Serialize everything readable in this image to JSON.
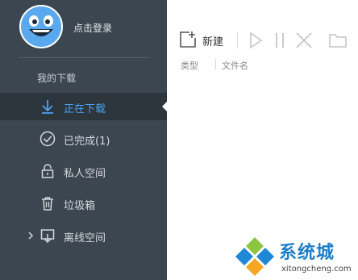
{
  "user": {
    "login_label": "点击登录"
  },
  "sidebar": {
    "section_title": "我的下载",
    "items": [
      {
        "label": "正在下载",
        "icon": "download-arrow-icon",
        "active": true
      },
      {
        "label": "已完成(1)",
        "icon": "check-circle-icon",
        "active": false
      },
      {
        "label": "私人空间",
        "icon": "lock-icon",
        "active": false
      },
      {
        "label": "垃圾箱",
        "icon": "trash-icon",
        "active": false
      },
      {
        "label": "离线空间",
        "icon": "cloud-download-icon",
        "active": false
      }
    ]
  },
  "toolbar": {
    "new_label": "新建",
    "buttons": [
      "add-icon",
      "play-icon",
      "pause-icon",
      "delete-icon",
      "folder-icon"
    ]
  },
  "columns": {
    "type": "类型",
    "name": "文件名"
  },
  "watermark": {
    "title": "系统城",
    "domain": "xitongcheng.com"
  },
  "colors": {
    "sidebar_bg": "#3c4650",
    "active_bg": "#2d353d",
    "accent": "#4aa3ef",
    "avatar": "#5aa9ef"
  }
}
